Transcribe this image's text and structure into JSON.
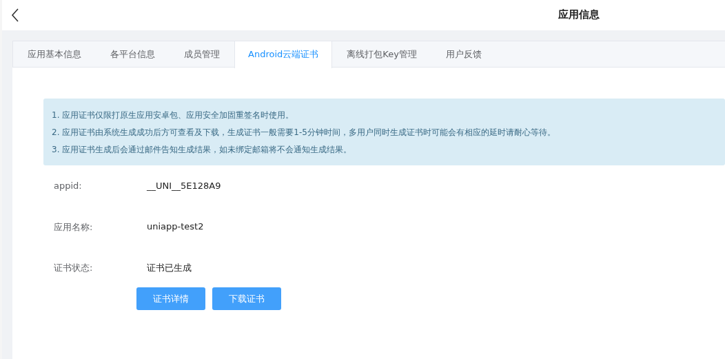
{
  "header": {
    "title": "应用信息"
  },
  "tabs": [
    {
      "label": "应用基本信息",
      "selected": false
    },
    {
      "label": "各平台信息",
      "selected": false
    },
    {
      "label": "成员管理",
      "selected": false
    },
    {
      "label": "Android云端证书",
      "selected": true
    },
    {
      "label": "离线打包Key管理",
      "selected": false
    },
    {
      "label": "用户反馈",
      "selected": false
    }
  ],
  "notice": [
    "1. 应用证书仅限打原生应用安卓包、应用安全加固重签名时使用。",
    "2. 应用证书由系统生成成功后方可查看及下载，生成证书一般需要1-5分钟时间，多用户同时生成证书时可能会有相应的延时请耐心等待。",
    "3. 应用证书生成后会通过邮件告知生成结果，如未绑定邮箱将不会通知生成结果。"
  ],
  "fields": [
    {
      "label": "appid:",
      "value": "__UNI__5E128A9"
    },
    {
      "label": "应用名称:",
      "value": "uniapp-test2"
    },
    {
      "label": "证书状态:",
      "value": "证书已生成"
    }
  ],
  "buttons": [
    "证书详情",
    "下载证书"
  ]
}
